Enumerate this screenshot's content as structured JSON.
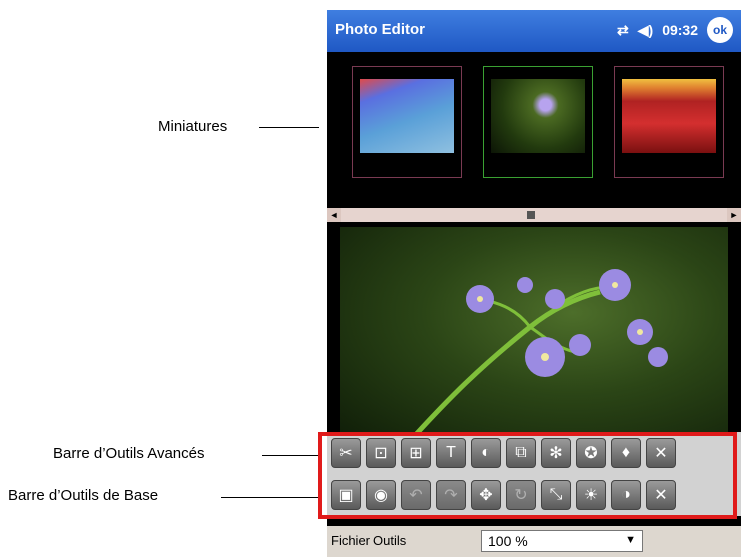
{
  "callouts": {
    "miniatures": "Miniatures",
    "advanced_toolbar": "Barre d’Outils Avancés",
    "basic_toolbar": "Barre d’Outils de Base"
  },
  "titlebar": {
    "title": "Photo Editor",
    "time": "09:32",
    "ok_label": "ok",
    "connectivity_icon": "sync-arrows-icon",
    "volume_icon": "speaker-icon"
  },
  "thumbnails": [
    {
      "name": "thumbnail-tulips-water",
      "selected": false
    },
    {
      "name": "thumbnail-purple-flower",
      "selected": true
    },
    {
      "name": "thumbnail-red-tulips",
      "selected": false
    }
  ],
  "scrollbar": {
    "left_arrow": "◄",
    "right_arrow": "►"
  },
  "toolbar_advanced": [
    {
      "icon": "cut-icon",
      "glyph": "✂",
      "enabled": true
    },
    {
      "icon": "crop-icon",
      "glyph": "⊡",
      "enabled": true
    },
    {
      "icon": "resize-icon",
      "glyph": "⊞",
      "enabled": true
    },
    {
      "icon": "text-icon",
      "glyph": "T",
      "enabled": true
    },
    {
      "icon": "color-wheel-icon",
      "glyph": "◐",
      "enabled": true
    },
    {
      "icon": "overlay-icon",
      "glyph": "⧉",
      "enabled": true
    },
    {
      "icon": "sparkle-icon",
      "glyph": "✻",
      "enabled": true
    },
    {
      "icon": "effect-icon",
      "glyph": "✪",
      "enabled": true
    },
    {
      "icon": "drop-icon",
      "glyph": "♦",
      "enabled": true
    },
    {
      "icon": "close-icon",
      "glyph": "✕",
      "enabled": true
    }
  ],
  "toolbar_basic": [
    {
      "icon": "save-image-icon",
      "glyph": "▣",
      "enabled": true
    },
    {
      "icon": "camera-icon",
      "glyph": "◉",
      "enabled": true
    },
    {
      "icon": "undo-icon",
      "glyph": "↶",
      "enabled": false
    },
    {
      "icon": "redo-icon",
      "glyph": "↷",
      "enabled": false
    },
    {
      "icon": "move-icon",
      "glyph": "✥",
      "enabled": true
    },
    {
      "icon": "rotate-icon",
      "glyph": "↻",
      "enabled": false
    },
    {
      "icon": "scale-icon",
      "glyph": "⤡",
      "enabled": true
    },
    {
      "icon": "brightness-icon",
      "glyph": "☀",
      "enabled": true
    },
    {
      "icon": "contrast-icon",
      "glyph": "◑",
      "enabled": true
    },
    {
      "icon": "close-icon",
      "glyph": "✕",
      "enabled": true
    }
  ],
  "menubar": {
    "fichier": "Fichier",
    "outils": "Outils",
    "zoom_value": "100 %",
    "zoom_arrow": "▼"
  }
}
